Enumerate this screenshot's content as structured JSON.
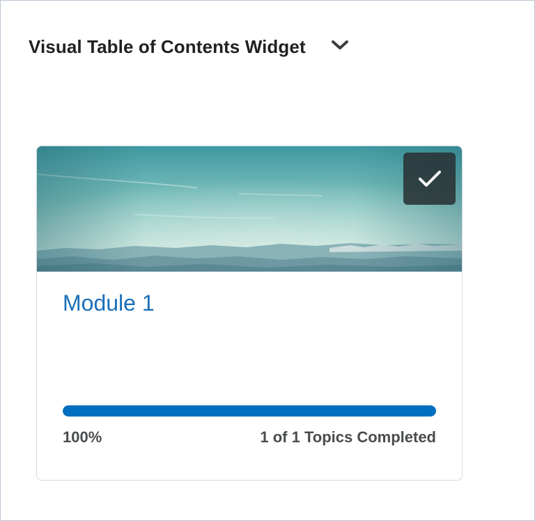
{
  "widget": {
    "title": "Visual Table of Contents Widget",
    "collapse_icon": "chevron-down-icon"
  },
  "modules": [
    {
      "title": "Module 1",
      "image": "mountain-sky-landscape",
      "completed": true,
      "status_icon": "checkmark-icon",
      "progress": {
        "fraction": 1.0,
        "percent_label": "100%",
        "topics_label": "1 of 1 Topics Completed"
      }
    }
  ],
  "colors": {
    "accent": "#006fbf",
    "link": "#1a6fb8",
    "text": "#202122",
    "muted_text": "#494c4e",
    "border": "#d3d9e3"
  }
}
